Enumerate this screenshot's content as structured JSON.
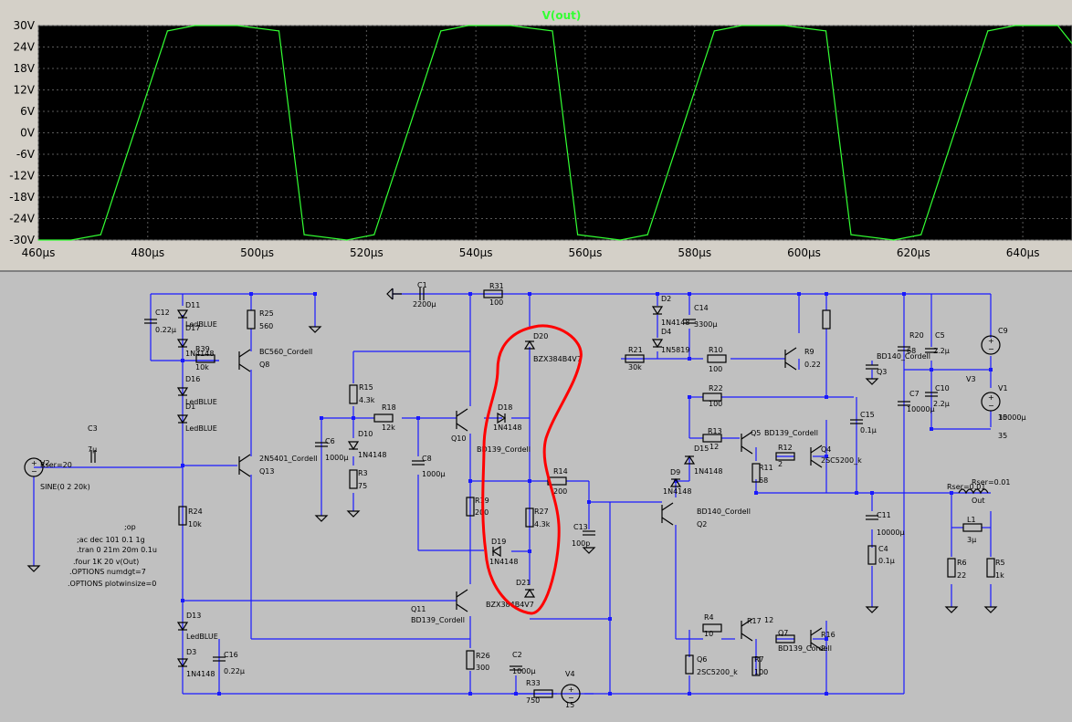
{
  "plot": {
    "trace_name": "V(out)",
    "trace_color": "#33ff33",
    "background": "#000000",
    "grid_color": "#5a5a5a",
    "axis_text_color": "#000000"
  },
  "chart_data": {
    "type": "line",
    "title": "V(out)",
    "xlabel": "",
    "ylabel": "",
    "xlim": [
      460,
      649
    ],
    "ylim": [
      -30,
      30
    ],
    "x_ticks": [
      "460µs",
      "480µs",
      "500µs",
      "520µs",
      "540µs",
      "560µs",
      "580µs",
      "600µs",
      "620µs",
      "640µs"
    ],
    "y_ticks": [
      "30V",
      "24V",
      "18V",
      "12V",
      "6V",
      "0V",
      "-6V",
      "-12V",
      "-18V",
      "-24V",
      "-30V"
    ],
    "grid": true,
    "series": [
      {
        "name": "V(out)",
        "x": [
          460,
          466,
          471.4,
          483.6,
          488.6,
          496.4,
          504,
          508.6,
          516.4,
          521.4,
          533.6,
          538.6,
          546.4,
          554,
          558.6,
          566.4,
          571.4,
          583.6,
          588.6,
          596.4,
          604,
          608.6,
          616.4,
          621.4,
          633.6,
          638.6,
          646.4,
          649
        ],
        "y": [
          -30,
          -30,
          -28.5,
          28.5,
          30,
          30,
          28.5,
          -28.5,
          -30,
          -28.5,
          28.5,
          30,
          30,
          28.5,
          -28.5,
          -30,
          -28.5,
          28.5,
          30,
          30,
          28.5,
          -28.5,
          -30,
          -28.5,
          28.5,
          30,
          30,
          25
        ]
      }
    ]
  },
  "schematic": {
    "labels": [
      "C1",
      "2200µ",
      "R31",
      "100",
      "C12",
      "0.22µ",
      "D11",
      "LedBLUE",
      "D17",
      "1N4148",
      "R39",
      "10k",
      "D16",
      "LedBLUE",
      "D1",
      "LedBLUE",
      "R25",
      "560",
      "BC560_Cordell",
      "Q8",
      "R15",
      "4.3k",
      "R18",
      "12k",
      "C6",
      "1000µ",
      "D10",
      "1N4148",
      "R3",
      "75",
      "C8",
      "1000µ",
      "Q10",
      "BD139_Cordell",
      "D18",
      "1N4148",
      "D20",
      "BZX384B4V7",
      "2N5401_Cordell",
      "Q13",
      "C3",
      "7µ",
      "V2",
      "Rser=20",
      "SINE(0 2 20k)",
      "R24",
      "10k",
      ";op",
      ";ac dec 101 0.1 1g",
      ".tran 0 21m 20m 0.1u",
      ".four 1K 20 v(Out)",
      ".OPTIONS numdgt=7",
      ".OPTIONS plotwinsize=0",
      "R19",
      "200",
      "R27",
      "4.3k",
      "R14",
      "200",
      "C13",
      "100p",
      "D19",
      "1N4148",
      "D21",
      "BZX384B4V7",
      "Q11",
      "BD139_Cordell",
      "D13",
      "LedBLUE",
      "D3",
      "1N4148",
      "C16",
      "0.22µ",
      "R26",
      "300",
      "C2",
      "1000µ",
      "R33",
      "750",
      "V4",
      "15",
      "D2",
      "1N4148",
      "D4",
      "1N5819",
      "C14",
      "3300µ",
      "R21",
      "30k",
      "R10",
      "100",
      "R22",
      "100",
      "R13",
      "12",
      "D15",
      "1N4148",
      "D9",
      "1N4148",
      "Q5",
      "BD139_Cordell",
      "R12",
      "2",
      "R11",
      "68",
      "Q4",
      "2SC5200_k",
      "BD140_Cordell",
      "Q2",
      "R9",
      "0.22",
      "BD140_Cordell",
      "Q3",
      "C15",
      "0.1µ",
      "C11",
      "10000µ",
      "C4",
      "0.1µ",
      "R4",
      "10",
      "R17",
      "12",
      "Q7",
      "BD139_Cordell",
      "R16",
      "2",
      "Q6",
      "2SC5200_k",
      "R7",
      "100",
      "R20",
      "68",
      "C5",
      "2.2µ",
      "C7",
      "10000µ",
      "C10",
      "2.2µ",
      "C9",
      "10000µ",
      "V1",
      "35",
      "V3",
      "35",
      "Rser=0.01",
      "Rser=0.01",
      "Out",
      "L1",
      "3µ",
      "R6",
      "22",
      "R5",
      "1k",
      "R8",
      "8"
    ],
    "highlight_color": "#ff0000"
  }
}
